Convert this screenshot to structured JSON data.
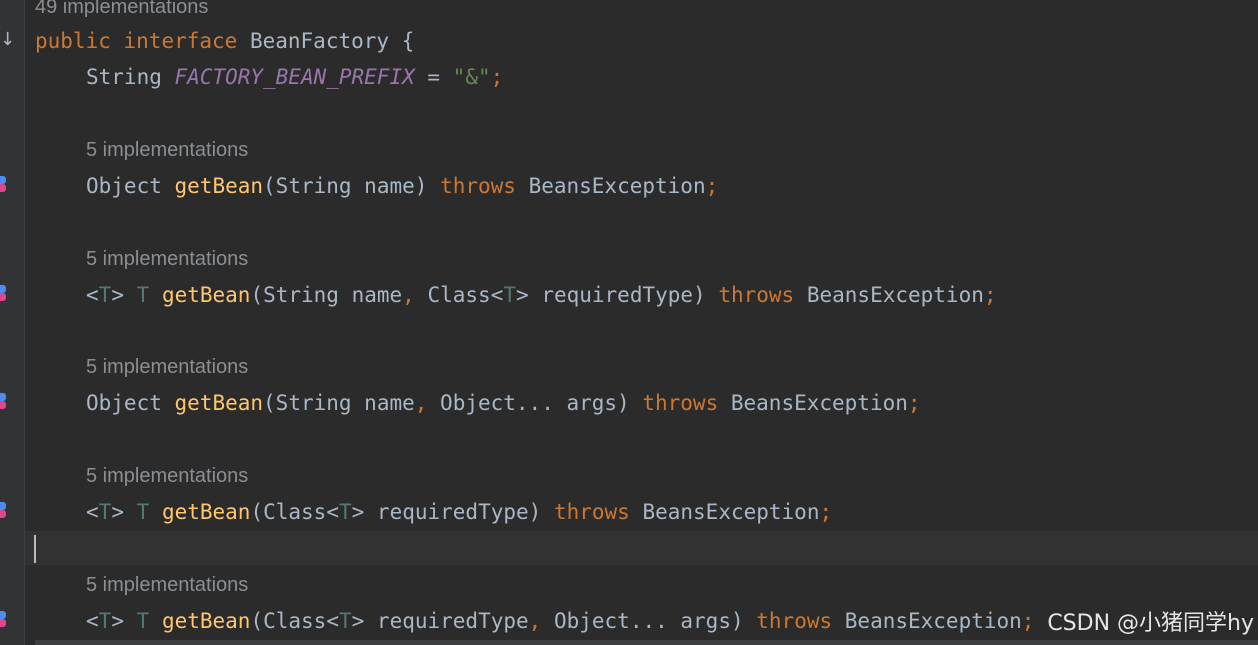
{
  "header_hint": "49 implementations",
  "impl_hint": "5 implementations",
  "code": {
    "kw_public": "public",
    "kw_interface": "interface",
    "interface_name": "BeanFactory",
    "open_brace": " {",
    "type_string": "String",
    "const_name": "FACTORY_BEAN_PREFIX",
    "assign": " = ",
    "string_value": "\"&\"",
    "semicolon": ";",
    "type_object": "Object",
    "method": "getBean",
    "kw_throws": "throws",
    "exception": "BeansException",
    "generic_t": "T",
    "lt": "<",
    "gt": ">",
    "class_kw": "Class",
    "param_string_name": "(String name)",
    "param_string_name_open": "(String name",
    "param_required_type": " requiredType)",
    "param_required_type_open": " requiredType",
    "param_object_args": " Object... args)",
    "comma": ",",
    "class_open": "(Class",
    "space": " "
  },
  "watermark": "CSDN @小猪同学hy",
  "colors": {
    "background": "#2b2b2b",
    "keyword": "#cc7832",
    "method": "#ffc66d",
    "constant": "#9876aa",
    "string": "#6a8759",
    "type_param": "#507874",
    "text": "#a9b7c6",
    "hint": "#8a8f94"
  },
  "icons": {
    "gutter_arrow": "implemented-arrow-icon",
    "gutter_marker": "implementation-marker-icon"
  }
}
